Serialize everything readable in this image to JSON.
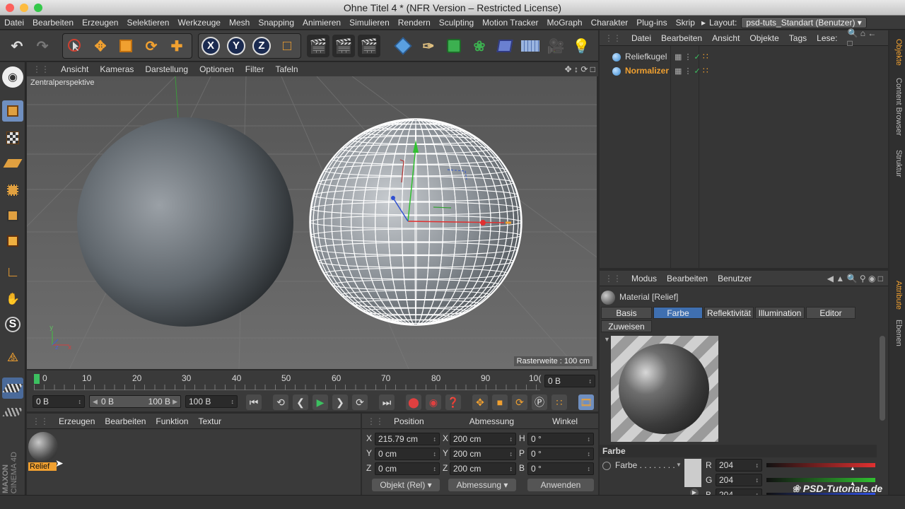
{
  "window": {
    "title": "Ohne Titel 4 * (NFR Version – Restricted License)"
  },
  "menu": [
    "Datei",
    "Bearbeiten",
    "Erzeugen",
    "Selektieren",
    "Werkzeuge",
    "Mesh",
    "Snapping",
    "Animieren",
    "Simulieren",
    "Rendern",
    "Sculpting",
    "Motion Tracker",
    "MoGraph",
    "Charakter",
    "Plug-ins",
    "Skrip"
  ],
  "layout": {
    "label": "Layout:",
    "value": "psd-tuts_Standart (Benutzer)"
  },
  "toolbar": {
    "x_label": "X",
    "y_label": "Y",
    "z_label": "Z"
  },
  "viewport": {
    "menu": [
      "Ansicht",
      "Kameras",
      "Darstellung",
      "Optionen",
      "Filter",
      "Tafeln"
    ],
    "camera_label": "Zentralperspektive",
    "grid_info": "Rasterweite : 100 cm"
  },
  "timeline": {
    "ticks": [
      "0",
      "10",
      "20",
      "30",
      "40",
      "50",
      "60",
      "70",
      "80",
      "90",
      "10("
    ],
    "current_frame": "0 B"
  },
  "transport": {
    "start": "0 B",
    "range_start": "0 B",
    "range_end": "100 B",
    "end": "100 B"
  },
  "material_manager": {
    "menu": [
      "Erzeugen",
      "Bearbeiten",
      "Funktion",
      "Textur"
    ],
    "materials": [
      {
        "name": "Relief"
      }
    ]
  },
  "coordinates": {
    "headers": {
      "position": "Position",
      "size": "Abmessung",
      "rotation": "Winkel"
    },
    "rows": [
      {
        "axis": "X",
        "pos": "215.79 cm",
        "size_axis": "X",
        "size": "200 cm",
        "rot_axis": "H",
        "rot": "0 °"
      },
      {
        "axis": "Y",
        "pos": "0 cm",
        "size_axis": "Y",
        "size": "200 cm",
        "rot_axis": "P",
        "rot": "0 °"
      },
      {
        "axis": "Z",
        "pos": "0 cm",
        "size_axis": "Z",
        "size": "200 cm",
        "rot_axis": "B",
        "rot": "0 °"
      }
    ],
    "mode_select": "Objekt (Rel)",
    "size_select": "Abmessung",
    "apply": "Anwenden"
  },
  "objects": {
    "menu": [
      "Datei",
      "Bearbeiten",
      "Ansicht",
      "Objekte",
      "Tags",
      "Lese:"
    ],
    "items": [
      {
        "name": "Reliefkugel",
        "color": "#dddddd"
      },
      {
        "name": "Normalizer",
        "color": "#f0a030"
      }
    ]
  },
  "side_tabs": {
    "right_top": [
      "Objekte",
      "Content Browser",
      "Struktur"
    ],
    "right_bottom": [
      "Attribute",
      "Ebenen"
    ]
  },
  "attributes": {
    "menu": [
      "Modus",
      "Bearbeiten",
      "Benutzer"
    ],
    "title": "Material [Relief]",
    "tabs": [
      "Basis",
      "Farbe",
      "Reflektivität",
      "Illumination",
      "Editor",
      "Zuweisen"
    ],
    "active_tab": "Farbe",
    "section": "Farbe",
    "color_label": "Farbe . . . . . . . .",
    "r_label": "R",
    "r": "204",
    "g_label": "G",
    "g": "204",
    "b_label": "B",
    "b": "204"
  },
  "branding": {
    "maxon": "MAXON",
    "cinema": "CINEMA 4D",
    "watermark": "PSD-Tutorials.de"
  },
  "colors": {
    "accent": "#f0a030",
    "panel": "#3a3a3a",
    "active_tab": "#3f6fb0"
  }
}
